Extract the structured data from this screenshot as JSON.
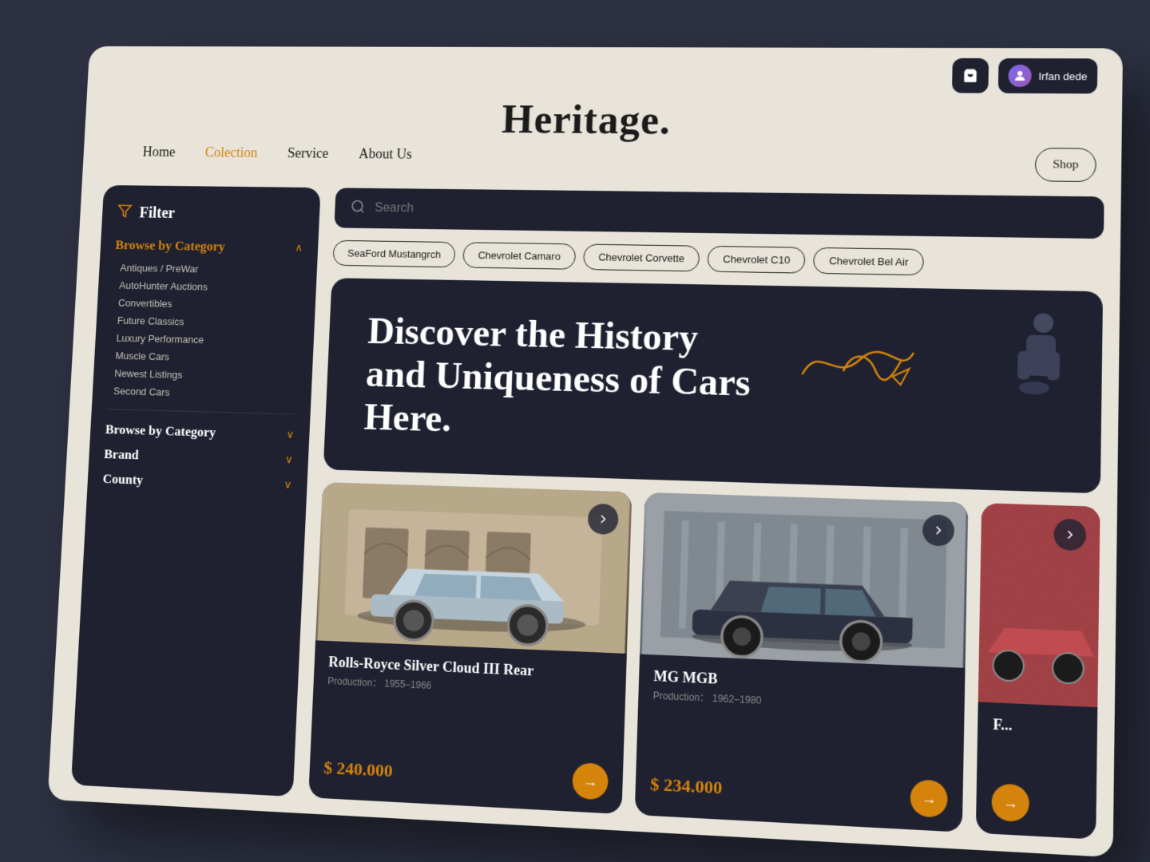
{
  "brand": {
    "title": "Heritage",
    "dot": "."
  },
  "topbar": {
    "cart_label": "cart",
    "user_name": "Irfan dede"
  },
  "nav": {
    "items": [
      {
        "label": "Home",
        "active": false
      },
      {
        "label": "Colection",
        "active": true
      },
      {
        "label": "Service",
        "active": false
      },
      {
        "label": "About Us",
        "active": false
      }
    ],
    "shop_label": "Shop"
  },
  "sidebar": {
    "filter_label": "Filter",
    "browse_category_active": {
      "label": "Browse by Category",
      "items": [
        "Antiques / PreWar",
        "AutoHunter Auctions",
        "Convertibles",
        "Future Classics",
        "Luxury Performance",
        "Muscle Cars",
        "Newest Listings",
        "Second Cars"
      ]
    },
    "browse_category_2": {
      "label": "Browse by Category"
    },
    "brand": {
      "label": "Brand"
    },
    "county": {
      "label": "County"
    }
  },
  "search": {
    "placeholder": "Search"
  },
  "chips": [
    "SeaFord Mustangrch",
    "Chevrolet Camaro",
    "Chevrolet Corvette",
    "Chevrolet C10",
    "Chevrolet Bel Air"
  ],
  "hero": {
    "title": "Discover the History and Uniqueness of Cars Here."
  },
  "cars": [
    {
      "name": "Rolls-Royce Silver Cloud III Rear",
      "production_label": "Production：",
      "production_years": "1955–1966",
      "price": "$ 240.000",
      "color_theme": "warm"
    },
    {
      "name": "MG MGB",
      "production_label": "Production：",
      "production_years": "1962–1980",
      "price": "$ 234.000",
      "color_theme": "cool"
    },
    {
      "name": "F...",
      "production_label": "",
      "production_years": "",
      "price": "",
      "color_theme": "red"
    }
  ],
  "colors": {
    "accent": "#d4830a",
    "dark_bg": "#1e2030",
    "light_bg": "#e8e4d9",
    "text_light": "#c5c0b5",
    "outer_bg": "#2d3142"
  }
}
